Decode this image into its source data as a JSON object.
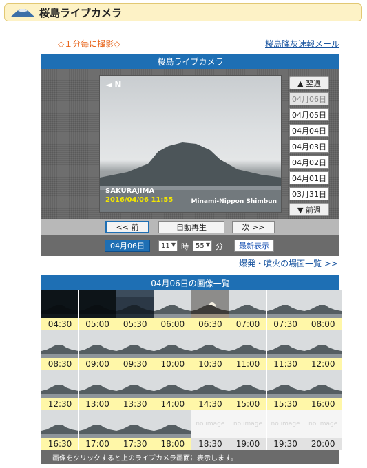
{
  "header": {
    "title": "桜島ライブカメラ"
  },
  "note": "◇１分毎に撮影◇",
  "mail_link": "桜島降灰速報メール",
  "camera": {
    "title": "桜島ライブカメラ",
    "direction": "◄ N",
    "place": "SAKURAJIMA",
    "datetime": "2016/04/06  11:55",
    "credit": "Minami-Nippon Shimbun"
  },
  "week_nav": {
    "next_week": "▲ 翌週",
    "prev_week": "▼ 前週",
    "days": [
      "04月06日",
      "04月05日",
      "04月04日",
      "04月03日",
      "04月02日",
      "04月01日",
      "03月31日"
    ],
    "selected_index": 0
  },
  "controls": {
    "prev": "<< 前",
    "autoplay": "自動再生",
    "next": "次 >>",
    "date": "04月06日",
    "hour": "11",
    "hour_unit": "時",
    "minute": "55",
    "minute_unit": "分",
    "latest": "最新表示"
  },
  "eruption_link": "爆発・噴火の場面一覧 >>",
  "gallery": {
    "title": "04月06日の画像一覧",
    "no_image_text": "no image",
    "times": [
      "04:30",
      "05:00",
      "05:30",
      "06:00",
      "06:30",
      "07:00",
      "07:30",
      "08:00",
      "08:30",
      "09:00",
      "09:30",
      "10:00",
      "10:30",
      "11:00",
      "11:30",
      "12:00",
      "12:30",
      "13:00",
      "13:30",
      "14:00",
      "14:30",
      "15:00",
      "15:30",
      "16:00",
      "16:30",
      "17:00",
      "17:30",
      "18:00",
      "18:30",
      "19:00",
      "19:30",
      "20:00"
    ],
    "kinds": [
      "night",
      "night",
      "dawn",
      "day",
      "sunrise",
      "day",
      "day",
      "day",
      "day",
      "day",
      "day",
      "day",
      "day",
      "day",
      "day",
      "day",
      "day",
      "day",
      "day",
      "day",
      "day",
      "day",
      "day",
      "day",
      "day",
      "day",
      "day",
      "day",
      "none",
      "none",
      "none",
      "none"
    ],
    "footer": "画像をクリックすると上のライブカメラ画面に表示します。"
  }
}
